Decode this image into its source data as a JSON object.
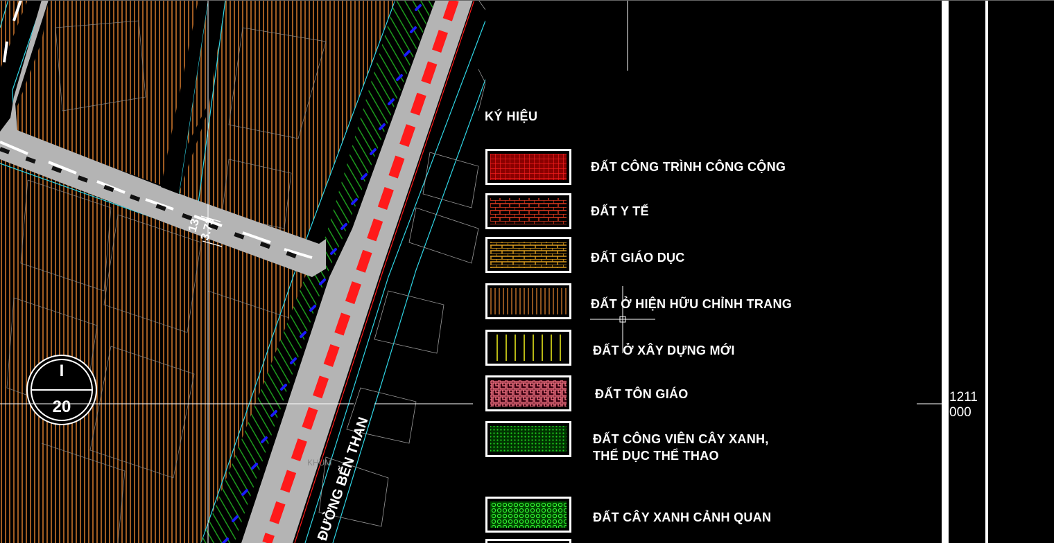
{
  "legend": {
    "title": "KÝ HIỆU",
    "items": [
      {
        "label": "ĐẤT CÔNG TRÌNH CÔNG CỘNG",
        "pattern": "grid-red"
      },
      {
        "label": "ĐẤT Y TẾ",
        "pattern": "brick-red"
      },
      {
        "label": "ĐẤT GIÁO DỤC",
        "pattern": "brick-yellow"
      },
      {
        "label": "ĐẤT Ở HIỆN HỮU CHỈNH TRANG",
        "pattern": "lines-orange"
      },
      {
        "label": "ĐẤT Ở XÂY DỰNG MỚI",
        "pattern": "lines-yellow"
      },
      {
        "label": "ĐẤT TÔN GIÁO",
        "pattern": "ornament-pink"
      },
      {
        "label_line1": "ĐẤT CÔNG VIÊN CÂY XANH,",
        "label_line2": "THỂ DỤC THỂ THAO",
        "pattern": "dots-green"
      },
      {
        "label": "ĐẤT CÂY XANH CẢNH QUAN",
        "pattern": "circles-green"
      }
    ]
  },
  "map": {
    "road_label": "ĐƯỜNG BẾN THAN",
    "dim_label_1": "13",
    "dim_label_2": "3.73",
    "khum_label": "KHUM",
    "section_marker_top": "I",
    "section_marker_bottom": "20"
  },
  "frame": {
    "scale_top": "1211",
    "scale_bottom": "000"
  },
  "colors": {
    "background": "#000000",
    "residential_hatch": "#c8742a",
    "road": "#b4b4b4",
    "road_dash": "#ff1a1a",
    "park_green": "#1faa1f",
    "tree_blue": "#1a1aff",
    "boundary_cyan": "#2fd6e6"
  }
}
